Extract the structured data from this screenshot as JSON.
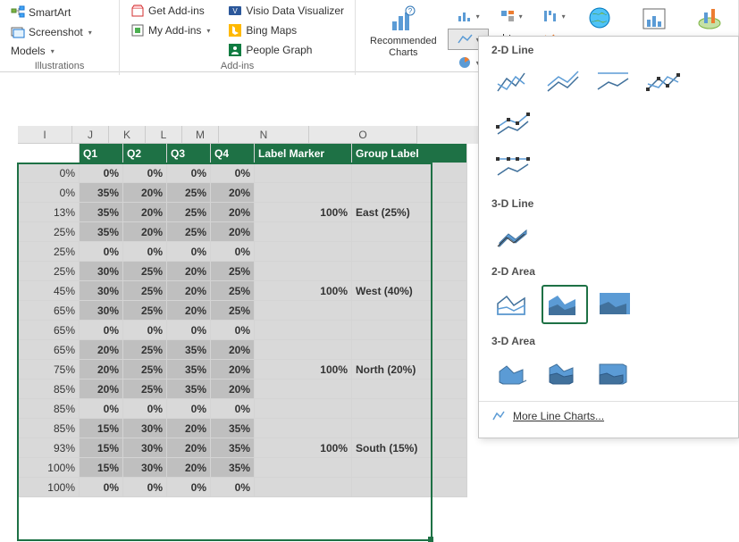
{
  "ribbon": {
    "illustrations": {
      "smartart": "SmartArt",
      "screenshot": "Screenshot",
      "models": "Models",
      "group": "Illustrations"
    },
    "addins": {
      "get": "Get Add-ins",
      "my": "My Add-ins",
      "visio": "Visio Data Visualizer",
      "bing": "Bing Maps",
      "people": "People Graph",
      "group": "Add-ins"
    },
    "charts": {
      "recommended": "Recommended\nCharts",
      "maps": "Maps",
      "pivot": "PivotChart",
      "threed": "3D"
    }
  },
  "dropdown": {
    "s1": "2-D Line",
    "s2": "3-D Line",
    "s3": "2-D Area",
    "s4": "3-D Area",
    "more": "More Line Charts..."
  },
  "cols": [
    "I",
    "J",
    "K",
    "L",
    "M",
    "N",
    "O"
  ],
  "headers": {
    "q1": "Q1",
    "q2": "Q2",
    "q3": "Q3",
    "q4": "Q4",
    "lm": "Label Marker",
    "gl": "Group Label"
  },
  "rows": [
    {
      "i": "0%",
      "j": "0%",
      "k": "0%",
      "l": "0%",
      "m": "0%",
      "n": "",
      "o": "",
      "s": 1
    },
    {
      "i": "0%",
      "j": "35%",
      "k": "20%",
      "l": "25%",
      "m": "20%",
      "n": "",
      "o": "",
      "s": 2
    },
    {
      "i": "13%",
      "j": "35%",
      "k": "20%",
      "l": "25%",
      "m": "20%",
      "n": "100%",
      "o": "East (25%)",
      "s": 2
    },
    {
      "i": "25%",
      "j": "35%",
      "k": "20%",
      "l": "25%",
      "m": "20%",
      "n": "",
      "o": "",
      "s": 2
    },
    {
      "i": "25%",
      "j": "0%",
      "k": "0%",
      "l": "0%",
      "m": "0%",
      "n": "",
      "o": "",
      "s": 1
    },
    {
      "i": "25%",
      "j": "30%",
      "k": "25%",
      "l": "20%",
      "m": "25%",
      "n": "",
      "o": "",
      "s": 2
    },
    {
      "i": "45%",
      "j": "30%",
      "k": "25%",
      "l": "20%",
      "m": "25%",
      "n": "100%",
      "o": "West (40%)",
      "s": 2
    },
    {
      "i": "65%",
      "j": "30%",
      "k": "25%",
      "l": "20%",
      "m": "25%",
      "n": "",
      "o": "",
      "s": 2
    },
    {
      "i": "65%",
      "j": "0%",
      "k": "0%",
      "l": "0%",
      "m": "0%",
      "n": "",
      "o": "",
      "s": 1
    },
    {
      "i": "65%",
      "j": "20%",
      "k": "25%",
      "l": "35%",
      "m": "20%",
      "n": "",
      "o": "",
      "s": 2
    },
    {
      "i": "75%",
      "j": "20%",
      "k": "25%",
      "l": "35%",
      "m": "20%",
      "n": "100%",
      "o": "North (20%)",
      "s": 2
    },
    {
      "i": "85%",
      "j": "20%",
      "k": "25%",
      "l": "35%",
      "m": "20%",
      "n": "",
      "o": "",
      "s": 2
    },
    {
      "i": "85%",
      "j": "0%",
      "k": "0%",
      "l": "0%",
      "m": "0%",
      "n": "",
      "o": "",
      "s": 1
    },
    {
      "i": "85%",
      "j": "15%",
      "k": "30%",
      "l": "20%",
      "m": "35%",
      "n": "",
      "o": "",
      "s": 2
    },
    {
      "i": "93%",
      "j": "15%",
      "k": "30%",
      "l": "20%",
      "m": "35%",
      "n": "100%",
      "o": "South (15%)",
      "s": 2
    },
    {
      "i": "100%",
      "j": "15%",
      "k": "30%",
      "l": "20%",
      "m": "35%",
      "n": "",
      "o": "",
      "s": 2
    },
    {
      "i": "100%",
      "j": "0%",
      "k": "0%",
      "l": "0%",
      "m": "0%",
      "n": "",
      "o": "",
      "s": 1
    }
  ]
}
